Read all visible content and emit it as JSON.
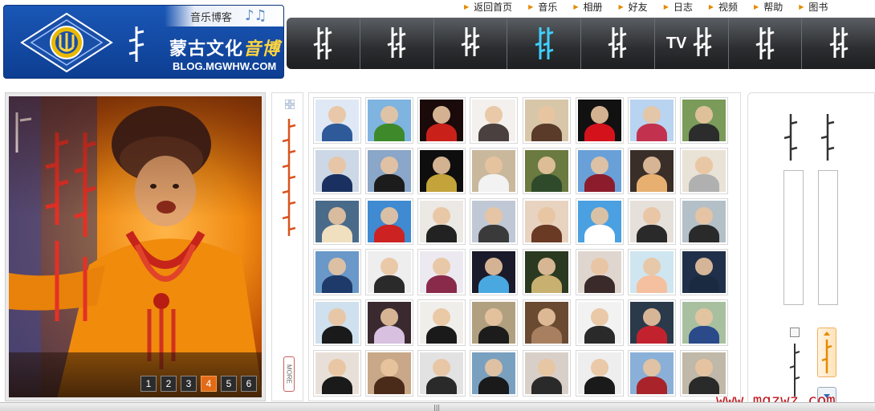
{
  "header": {
    "logo_title_prefix": "蒙古文化",
    "logo_title_highlight": "音博",
    "logo_url": "BLOG.MGWHW.COM",
    "logo_tagline": "音乐博客",
    "notes_glyph": "♪♫"
  },
  "top_links": [
    {
      "label": "返回首页",
      "icon": "arrow-right-icon"
    },
    {
      "label": "音乐",
      "icon": "arrow-right-icon"
    },
    {
      "label": "相册",
      "icon": "arrow-right-icon"
    },
    {
      "label": "好友",
      "icon": "arrow-right-icon"
    },
    {
      "label": "日志",
      "icon": "arrow-right-icon"
    },
    {
      "label": "视频",
      "icon": "arrow-right-icon"
    },
    {
      "label": "帮助",
      "icon": "arrow-right-icon"
    },
    {
      "label": "图书",
      "icon": "arrow-right-icon"
    }
  ],
  "main_nav": {
    "tab_count": 8,
    "active_index": 3,
    "tv_label": "TV",
    "active_color": "#3fd0ff",
    "text_color": "#ffffff"
  },
  "feature": {
    "pages": [
      "1",
      "2",
      "3",
      "4",
      "5",
      "6"
    ],
    "active_page": "4",
    "accent": "#e36b16"
  },
  "sidebar": {
    "more_label": "MORE",
    "title_color": "#d9531e"
  },
  "grid": {
    "rows": 6,
    "cols": 8
  },
  "watermark": "www.mgzwz.com",
  "scrollbar_grip": "|||"
}
